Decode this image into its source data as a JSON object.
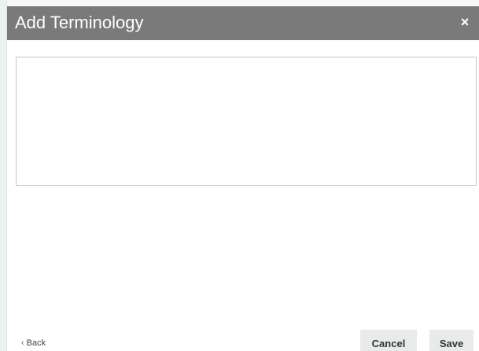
{
  "dialog": {
    "title": "Add Terminology",
    "close_glyph": "×",
    "close_icon": "close-icon"
  },
  "content": {
    "text": ""
  },
  "footer": {
    "back_glyph": "‹",
    "back_icon": "chevron-left-icon",
    "back_label": "Back",
    "cancel_label": "Cancel",
    "save_label": "Save"
  },
  "colors": {
    "header_background": "#7a7a7a",
    "header_text": "#ffffff",
    "button_background": "#e9ebeb",
    "content_border": "#c8c8c8"
  }
}
